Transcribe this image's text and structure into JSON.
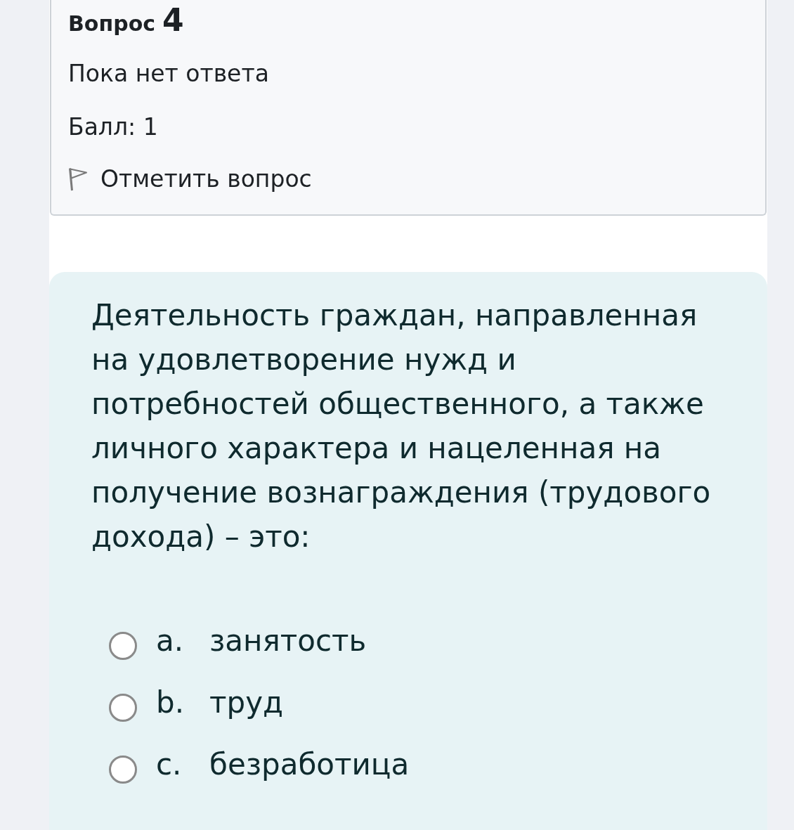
{
  "question_info": {
    "title": "Вопрос",
    "number": "4",
    "status": "Пока нет ответа",
    "mark": "Балл: 1",
    "flag_label": "Отметить вопрос",
    "flagged": false
  },
  "question": {
    "text": "Деятельность граждан, направленная на удовлетворение нужд и потребностей общественного, а также личного характера и нацеленная на получение вознаграждения (трудового дохода) – это:",
    "options": [
      {
        "letter": "a.",
        "label": "занятость",
        "selected": false
      },
      {
        "letter": "b.",
        "label": "труд",
        "selected": false
      },
      {
        "letter": "c.",
        "label": "безработица",
        "selected": false
      }
    ]
  }
}
